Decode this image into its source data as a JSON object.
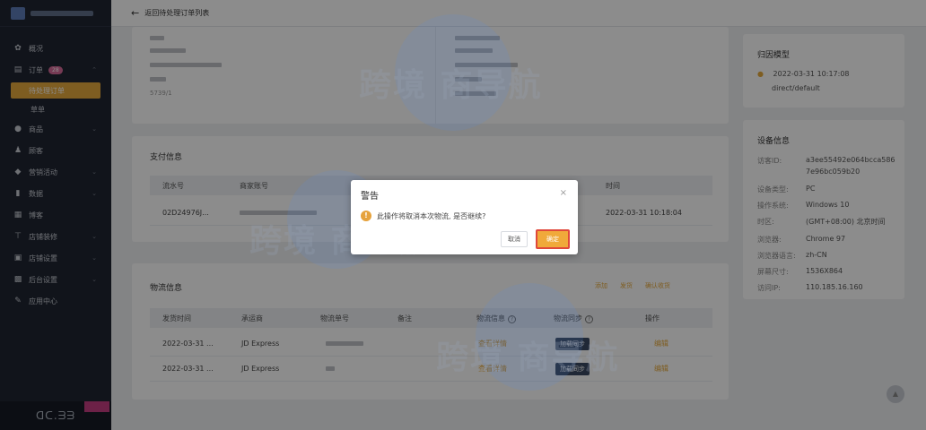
{
  "sidebar": {
    "items": [
      {
        "label": "概况",
        "icon": "gear-icon"
      },
      {
        "label": "订单",
        "icon": "list-icon",
        "badge": "28"
      },
      {
        "label": "商品",
        "icon": "cart-icon"
      },
      {
        "label": "顾客",
        "icon": "person-icon"
      },
      {
        "label": "营销活动",
        "icon": "tag-icon"
      },
      {
        "label": "数据",
        "icon": "chart-icon"
      },
      {
        "label": "博客",
        "icon": "doc-icon"
      },
      {
        "label": "店铺装修",
        "icon": "brush-icon"
      },
      {
        "label": "店铺设置",
        "icon": "shop-icon"
      },
      {
        "label": "后台设置",
        "icon": "settings-icon"
      },
      {
        "label": "应用中心",
        "icon": "app-icon"
      }
    ],
    "sub_items": [
      {
        "label": "待处理订单"
      },
      {
        "label": "草单"
      }
    ]
  },
  "topbar": {
    "back_label": "返回待处理订单列表"
  },
  "payment": {
    "title": "支付信息",
    "headers": [
      "流水号",
      "商家账号",
      "时间"
    ],
    "row": {
      "serial": "02D24976J...",
      "time": "2022-03-31 10:18:04"
    }
  },
  "address": {
    "postcode_partial": "5739/1"
  },
  "logistics": {
    "title": "物流信息",
    "actions": [
      "添加",
      "发货",
      "确认收货"
    ],
    "headers": [
      "发货时间",
      "承运商",
      "物流单号",
      "备注",
      "物流信息",
      "物流同步",
      "操作"
    ],
    "rows": [
      {
        "time": "2022-03-31 ...",
        "carrier": "JD Express",
        "info": "查看详情",
        "sync": "加载同步",
        "op": "编辑"
      },
      {
        "time": "2022-03-31 ...",
        "carrier": "JD Express",
        "info": "查看详情",
        "sync": "加载同步",
        "op": "编辑"
      }
    ]
  },
  "attribution": {
    "title": "归因模型",
    "time": "2022-03-31 10:17:08",
    "value": "direct/default"
  },
  "device": {
    "title": "设备信息",
    "rows": [
      {
        "label": "访客ID:",
        "value": "a3ee55492e064bcca586"
      },
      {
        "label": "",
        "value": "7e96bc059b20"
      },
      {
        "label": "设备类型:",
        "value": "PC"
      },
      {
        "label": "操作系统:",
        "value": "Windows 10"
      },
      {
        "label": "时区:",
        "value": "(GMT+08:00) 北京时间"
      },
      {
        "label": "浏览器:",
        "value": "Chrome 97"
      },
      {
        "label": "浏览器语言:",
        "value": "zh-CN"
      },
      {
        "label": "屏幕尺寸:",
        "value": "1536X864"
      },
      {
        "label": "访问IP:",
        "value": "110.185.16.160"
      }
    ]
  },
  "watermark": {
    "text": "跨境  商导航"
  },
  "dialog": {
    "title": "警告",
    "message": "此操作将取消本次物流, 是否继续?",
    "cancel": "取消",
    "ok": "确定"
  },
  "colors": {
    "accent": "#e6a93c",
    "sidebar": "#1f2532",
    "highlight": "#e0483a"
  }
}
